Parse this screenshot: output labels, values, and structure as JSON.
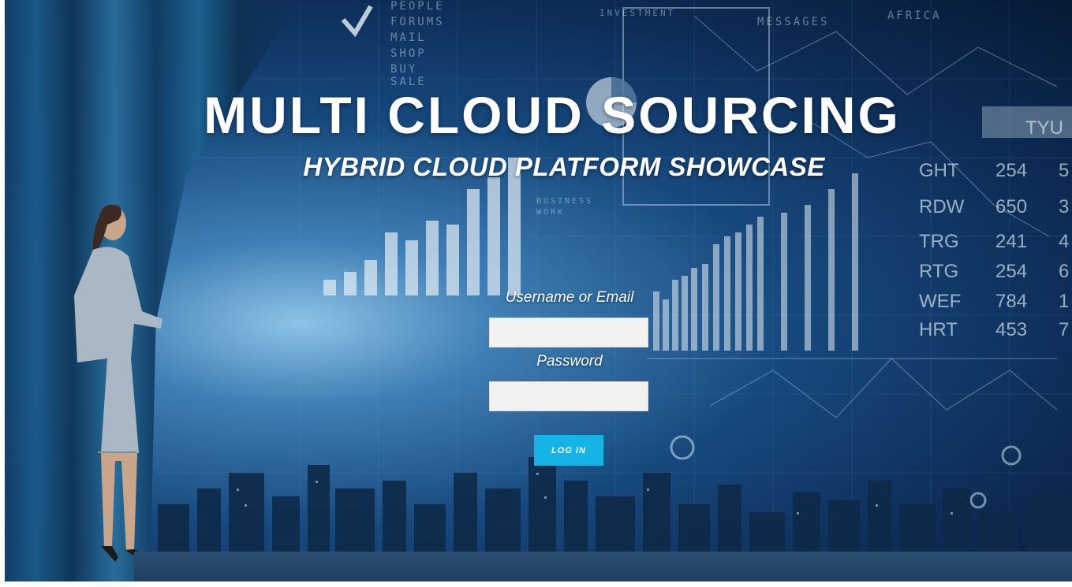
{
  "header": {
    "title": "MULTI CLOUD SOURCING",
    "subtitle": "HYBRID CLOUD PLATFORM SHOWCASE"
  },
  "login_form": {
    "username_label": "Username or Email",
    "username_value": "",
    "password_label": "Password",
    "password_value": "",
    "login_button_label": "LOG IN"
  },
  "background": {
    "words": [
      "PEOPLE",
      "FORUMS",
      "MAIL",
      "SHOP",
      "BUY",
      "SALE",
      "INVESTMENT",
      "MESSAGES",
      "AFRICA",
      "BUSINESS",
      "WORK"
    ],
    "table_header": "TYU",
    "table_rows": [
      [
        "GHT",
        "254",
        "5"
      ],
      [
        "RDW",
        "650",
        "3"
      ],
      [
        "TRG",
        "241",
        "4"
      ],
      [
        "RTG",
        "254",
        "6"
      ],
      [
        "WEF",
        "784",
        "1"
      ],
      [
        "HRT",
        "453",
        "7"
      ]
    ]
  },
  "colors": {
    "button": "#16b3e6",
    "input_bg": "#f2f2f2",
    "text": "#ffffff"
  }
}
